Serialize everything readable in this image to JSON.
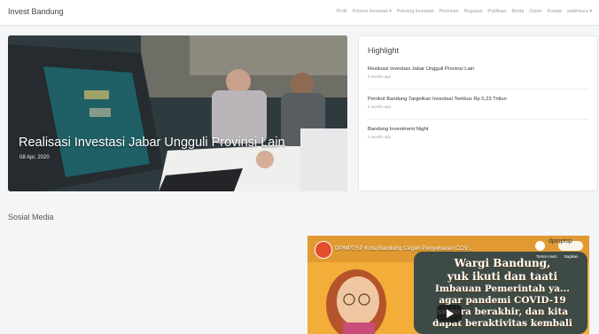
{
  "brand": "Invest Bandung",
  "nav": {
    "items": [
      "Profil",
      "Potensi Investasi ▾",
      "Peluang Investasi",
      "Perizinan",
      "Regulasi",
      "Publikasi",
      "Berita",
      "Galeri",
      "Kontak",
      "adathaura ▾"
    ]
  },
  "hero": {
    "title": "Realisasi Investasi Jabar Ungguli Provinsi Lain",
    "date": "08 Apr, 2020"
  },
  "highlight": {
    "title": "Highlight",
    "items": [
      {
        "title": "Realisasi Investasi Jabar Ungguli Provinsi Lain",
        "time": "2 months ago"
      },
      {
        "title": "Pemkot Bandung Targetkan Investasi Tembus Rp 5,23 Triliun",
        "time": "2 months ago"
      },
      {
        "title": "Bandung Investment Night",
        "time": "2 months ago"
      }
    ]
  },
  "social": {
    "title": "Sosial Media",
    "video": {
      "title": "DPMPTSP Kota Bandung Cegah Penyebaran COV...",
      "watch_later": "Tonton nanti",
      "share": "Bagikan",
      "share_badge": "dpmptsp",
      "lines": [
        "Wargi Bandung,",
        "yuk ikuti dan taati",
        "Imbauan Pemerintah ya...",
        "agar pandemi COVID-19",
        "segera berakhir, dan kita",
        "dapat beraktivitas kembali"
      ]
    }
  },
  "colors": {
    "accent": "#f4b13a",
    "nav_text": "#9aa0a8",
    "background": "#f4f5f7"
  }
}
